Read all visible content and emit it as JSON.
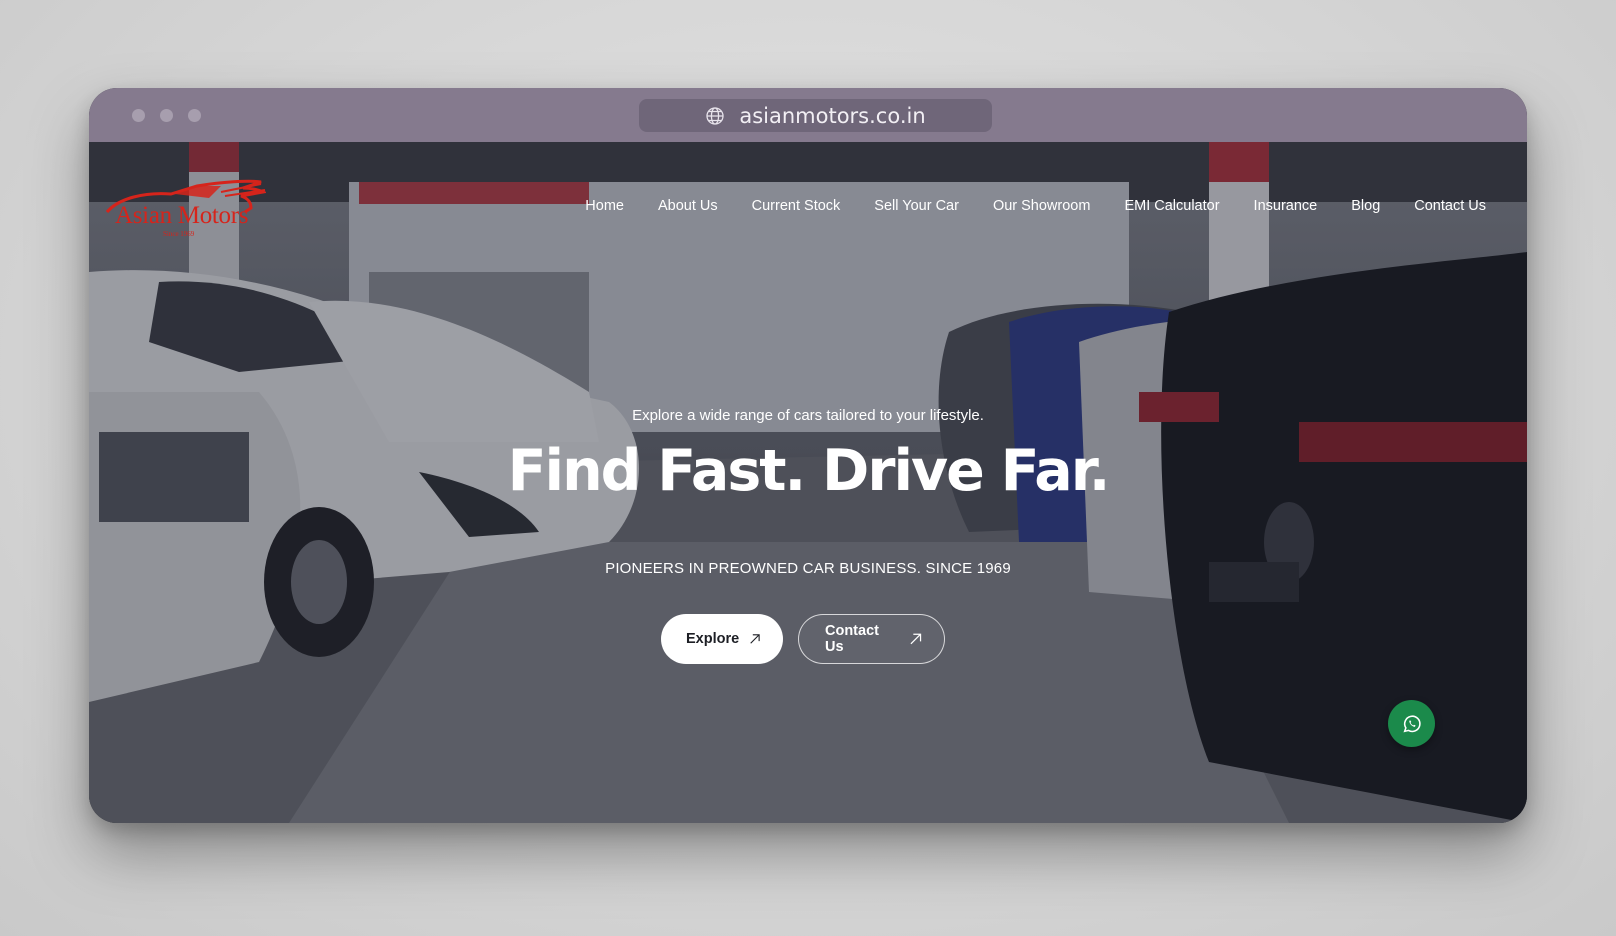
{
  "browser": {
    "url": "asianmotors.co.in",
    "window_dots": [
      "close-dot",
      "minimize-dot",
      "maximize-dot"
    ]
  },
  "brand": {
    "name": "Asian Motors",
    "tagline": "Since 1969",
    "color": "#d6241b"
  },
  "nav": {
    "items": [
      {
        "label": "Home"
      },
      {
        "label": "About Us"
      },
      {
        "label": "Current Stock"
      },
      {
        "label": "Sell Your Car"
      },
      {
        "label": "Our Showroom"
      },
      {
        "label": "EMI Calculator"
      },
      {
        "label": "Insurance"
      },
      {
        "label": "Blog"
      },
      {
        "label": "Contact Us"
      }
    ]
  },
  "hero": {
    "tagline": "Explore a wide range of cars tailored to your lifestyle.",
    "headline": "Find Fast. Drive Far.",
    "subline": "PIONEERS IN PREOWNED CAR BUSINESS. SINCE 1969",
    "buttons": {
      "explore": {
        "label": "Explore",
        "icon": "arrow-up-right-icon"
      },
      "contact": {
        "label": "Contact Us",
        "icon": "arrow-up-right-icon"
      }
    },
    "background": "showroom-parking-photo"
  },
  "floating": {
    "whatsapp": {
      "icon": "whatsapp-icon",
      "color": "#1b8a4b"
    }
  }
}
